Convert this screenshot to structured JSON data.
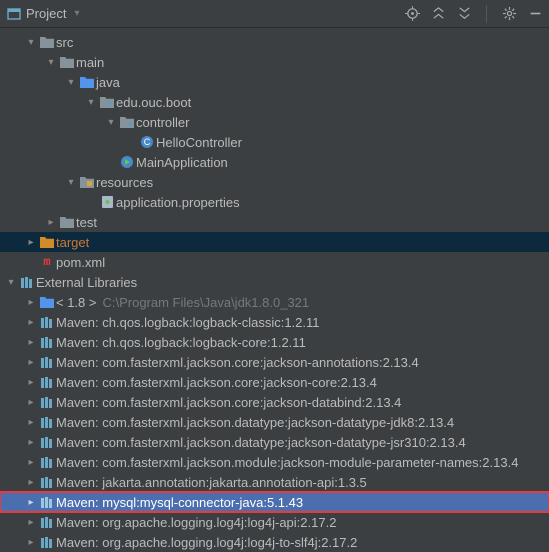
{
  "header": {
    "title": "Project",
    "dropdown_glyph": "▾"
  },
  "tree": {
    "src": "src",
    "main": "main",
    "java": "java",
    "pkg": "edu.ouc.boot",
    "controller": "controller",
    "hello": "HelloController",
    "mainapp": "MainApplication",
    "resources": "resources",
    "appprops": "application.properties",
    "test": "test",
    "target": "target",
    "pom": "pom.xml",
    "extlibs": "External Libraries",
    "jdk_prefix": "< 1.8 >",
    "jdk_path": "C:\\Program Files\\Java\\jdk1.8.0_321",
    "maven": [
      "Maven: ch.qos.logback:logback-classic:1.2.11",
      "Maven: ch.qos.logback:logback-core:1.2.11",
      "Maven: com.fasterxml.jackson.core:jackson-annotations:2.13.4",
      "Maven: com.fasterxml.jackson.core:jackson-core:2.13.4",
      "Maven: com.fasterxml.jackson.core:jackson-databind:2.13.4",
      "Maven: com.fasterxml.jackson.datatype:jackson-datatype-jdk8:2.13.4",
      "Maven: com.fasterxml.jackson.datatype:jackson-datatype-jsr310:2.13.4",
      "Maven: com.fasterxml.jackson.module:jackson-module-parameter-names:2.13.4",
      "Maven: jakarta.annotation:jakarta.annotation-api:1.3.5",
      "Maven: mysql:mysql-connector-java:5.1.43",
      "Maven: org.apache.logging.log4j:log4j-api:2.17.2",
      "Maven: org.apache.logging.log4j:log4j-to-slf4j:2.17.2"
    ]
  }
}
